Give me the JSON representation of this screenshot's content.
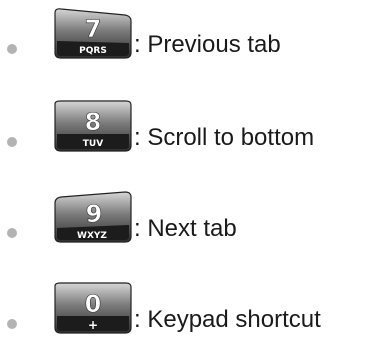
{
  "shortcuts": [
    {
      "key_number": "7",
      "key_letters": "PQRS",
      "description": ": Previous tab",
      "icon": "keypad-7-key-icon"
    },
    {
      "key_number": "8",
      "key_letters": "TUV",
      "description": ": Scroll to bottom",
      "icon": "keypad-8-key-icon"
    },
    {
      "key_number": "9",
      "key_letters": "WXYZ",
      "description": ": Next tab",
      "icon": "keypad-9-key-icon"
    },
    {
      "key_number": "0",
      "key_letters": "+",
      "description": ": Keypad shortcut",
      "icon": "keypad-0-key-icon"
    }
  ]
}
